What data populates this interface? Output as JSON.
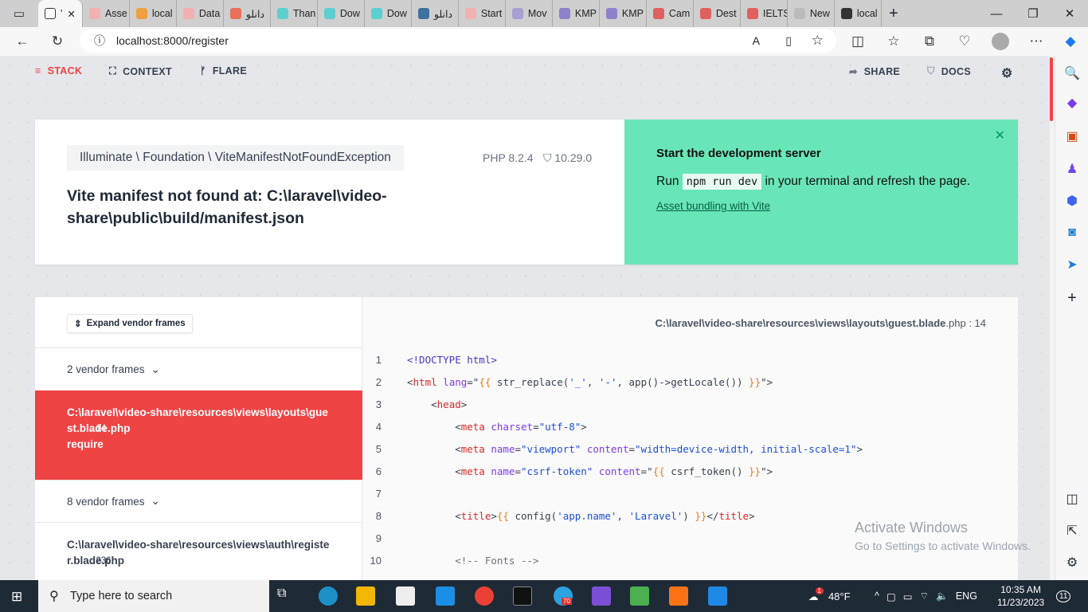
{
  "browser": {
    "tabs": [
      {
        "label": "'",
        "icon": "page-icon",
        "active": true
      },
      {
        "label": "Asse",
        "icon": "laravel-icon"
      },
      {
        "label": "local",
        "icon": "phpmyadmin-icon"
      },
      {
        "label": "Data",
        "icon": "laravel-icon"
      },
      {
        "label": "دانلو",
        "icon": "yandex-icon"
      },
      {
        "label": "Than",
        "icon": "arrow-icon"
      },
      {
        "label": "Dow",
        "icon": "arrow-icon"
      },
      {
        "label": "Dow",
        "icon": "arrow-icon"
      },
      {
        "label": "دانلو",
        "icon": "s-icon"
      },
      {
        "label": "Start",
        "icon": "laravel-icon"
      },
      {
        "label": "Mov",
        "icon": "video-icon"
      },
      {
        "label": "KMP",
        "icon": "kmp-icon"
      },
      {
        "label": "KMP",
        "icon": "kmp-icon"
      },
      {
        "label": "Cam",
        "icon": "pdf-icon"
      },
      {
        "label": "Dest",
        "icon": "pdf-icon"
      },
      {
        "label": "IELTS",
        "icon": "pdf-icon"
      },
      {
        "label": "New",
        "icon": "newtab-icon"
      },
      {
        "label": "local",
        "icon": "file-icon"
      }
    ],
    "url": "localhost:8000/register"
  },
  "nav": {
    "stack": "STACK",
    "context": "CONTEXT",
    "flare": "FLARE",
    "share": "SHARE",
    "docs": "DOCS"
  },
  "error": {
    "exception": "Illuminate \\ Foundation \\ ViteManifestNotFoundException",
    "php_version": "PHP 8.2.4",
    "laravel_version": "10.29.0",
    "message": "Vite manifest not found at: C:\\laravel\\video-share\\public\\build/manifest.json"
  },
  "solution": {
    "title": "Start the development server",
    "before": "Run ",
    "command": "npm run dev",
    "after": " in your terminal and refresh the page.",
    "link": "Asset bundling with Vite"
  },
  "stack": {
    "expand_label": "Expand vendor frames",
    "group1": "2 vendor frames",
    "selected": {
      "path": "C:\\laravel\\video-share\\resources\\views\\layouts\\guest.blade.php",
      "line": ": 14",
      "method": "require"
    },
    "group2": "8 vendor frames",
    "frame2": {
      "path": "C:\\laravel\\video-share\\resources\\views\\auth\\register.blade.php",
      "line": ": 236"
    }
  },
  "file": {
    "path": "C:\\laravel\\video-share\\resources\\views\\layouts\\guest.blade",
    "ext": ".php",
    "line": ": 14"
  },
  "code_lines": [
    {
      "n": "1",
      "tokens": [
        [
          "d",
          "<!DOCTYPE html>"
        ]
      ]
    },
    {
      "n": "2",
      "tokens": [
        [
          "p",
          "<"
        ],
        [
          "tag",
          "html"
        ],
        [
          "p",
          " "
        ],
        [
          "attr",
          "lang"
        ],
        [
          "p",
          "=\""
        ],
        [
          "br",
          "{{"
        ],
        [
          "p",
          " str_replace("
        ],
        [
          "str",
          "'_'"
        ],
        [
          "p",
          ", "
        ],
        [
          "str",
          "'-'"
        ],
        [
          "p",
          ", app()->getLocale()) "
        ],
        [
          "br",
          "}}"
        ],
        [
          "p",
          "\">"
        ]
      ]
    },
    {
      "n": "3",
      "tokens": [
        [
          "p",
          "    <"
        ],
        [
          "tag",
          "head"
        ],
        [
          "p",
          ">"
        ]
      ]
    },
    {
      "n": "4",
      "tokens": [
        [
          "p",
          "        <"
        ],
        [
          "tag",
          "meta"
        ],
        [
          "p",
          " "
        ],
        [
          "attr",
          "charset"
        ],
        [
          "p",
          "="
        ],
        [
          "str",
          "\"utf-8\""
        ],
        [
          "p",
          ">"
        ]
      ]
    },
    {
      "n": "5",
      "tokens": [
        [
          "p",
          "        <"
        ],
        [
          "tag",
          "meta"
        ],
        [
          "p",
          " "
        ],
        [
          "attr",
          "name"
        ],
        [
          "p",
          "="
        ],
        [
          "str",
          "\"viewport\""
        ],
        [
          "p",
          " "
        ],
        [
          "attr",
          "content"
        ],
        [
          "p",
          "="
        ],
        [
          "str",
          "\"width=device-width, initial-scale=1\""
        ],
        [
          "p",
          ">"
        ]
      ]
    },
    {
      "n": "6",
      "tokens": [
        [
          "p",
          "        <"
        ],
        [
          "tag",
          "meta"
        ],
        [
          "p",
          " "
        ],
        [
          "attr",
          "name"
        ],
        [
          "p",
          "="
        ],
        [
          "str",
          "\"csrf-token\""
        ],
        [
          "p",
          " "
        ],
        [
          "attr",
          "content"
        ],
        [
          "p",
          "=\""
        ],
        [
          "br",
          "{{"
        ],
        [
          "p",
          " csrf_token() "
        ],
        [
          "br",
          "}}"
        ],
        [
          "p",
          "\">"
        ]
      ]
    },
    {
      "n": "7",
      "tokens": []
    },
    {
      "n": "8",
      "tokens": [
        [
          "p",
          "        <"
        ],
        [
          "tag",
          "title"
        ],
        [
          "p",
          ">"
        ],
        [
          "br",
          "{{"
        ],
        [
          "p",
          " config("
        ],
        [
          "str",
          "'app.name'"
        ],
        [
          "p",
          ", "
        ],
        [
          "str",
          "'Laravel'"
        ],
        [
          "p",
          ") "
        ],
        [
          "br",
          "}}"
        ],
        [
          "p",
          "</"
        ],
        [
          "tag",
          "title"
        ],
        [
          "p",
          ">"
        ]
      ]
    },
    {
      "n": "9",
      "tokens": []
    },
    {
      "n": "10",
      "tokens": [
        [
          "c",
          "        <!-- Fonts -->"
        ]
      ]
    }
  ],
  "watermark": {
    "title": "Activate Windows",
    "subtitle": "Go to Settings to activate Windows."
  },
  "taskbar": {
    "search_placeholder": "Type here to search",
    "weather": "48°F",
    "lang": "ENG",
    "time": "10:35 AM",
    "date": "11/23/2023",
    "notifications": "11",
    "weather_badge": "1",
    "telegram_badge": "70"
  },
  "colors": {
    "accent": "#ef4444",
    "solution": "#69e6b7"
  }
}
